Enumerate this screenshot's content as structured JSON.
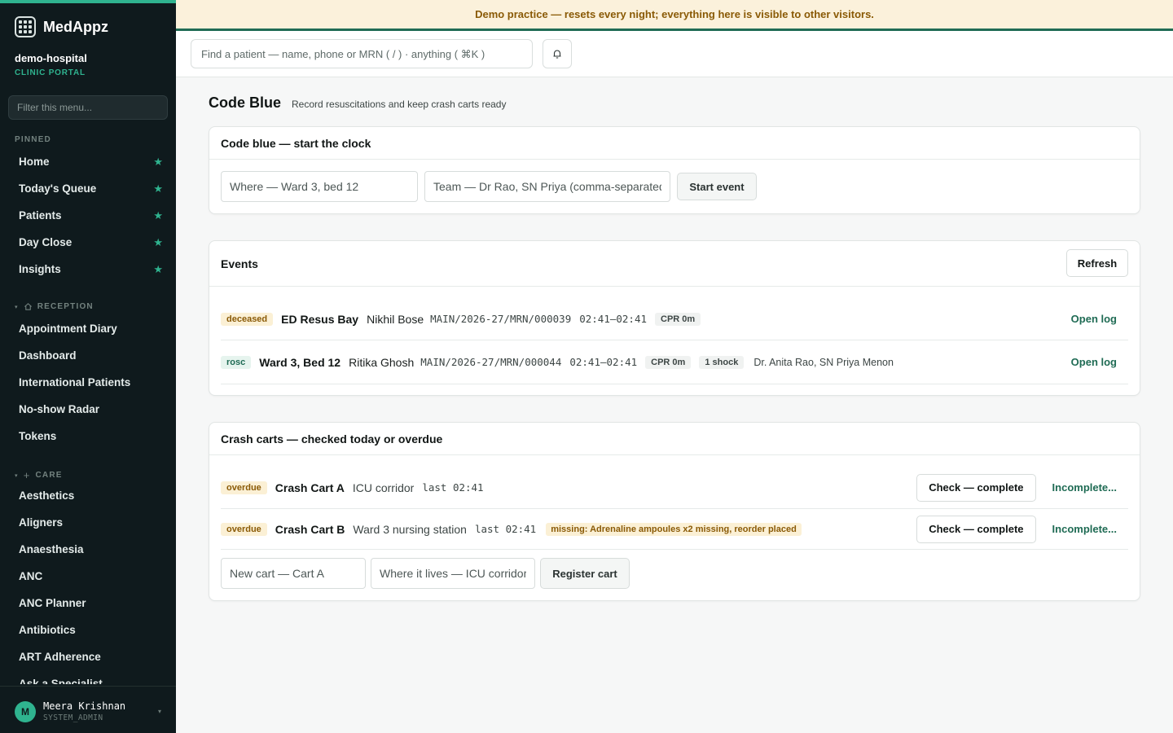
{
  "brand": {
    "name": "MedAppz"
  },
  "org": {
    "name": "demo-hospital",
    "subtitle": "CLINIC PORTAL"
  },
  "sidebar": {
    "filter_placeholder": "Filter this menu...",
    "pinned_label": "PINNED",
    "pinned": [
      {
        "label": "Home"
      },
      {
        "label": "Today's Queue"
      },
      {
        "label": "Patients"
      },
      {
        "label": "Day Close"
      },
      {
        "label": "Insights"
      }
    ],
    "reception_label": "RECEPTION",
    "reception": [
      {
        "label": "Appointment Diary"
      },
      {
        "label": "Dashboard"
      },
      {
        "label": "International Patients"
      },
      {
        "label": "No-show Radar"
      },
      {
        "label": "Tokens"
      }
    ],
    "care_label": "CARE",
    "care": [
      {
        "label": "Aesthetics"
      },
      {
        "label": "Aligners"
      },
      {
        "label": "Anaesthesia"
      },
      {
        "label": "ANC"
      },
      {
        "label": "ANC Planner"
      },
      {
        "label": "Antibiotics"
      },
      {
        "label": "ART Adherence"
      },
      {
        "label": "Ask a Specialist"
      }
    ]
  },
  "user": {
    "initial": "M",
    "name": "Meera Krishnan",
    "role": "SYSTEM_ADMIN"
  },
  "banner": {
    "text": "Demo practice — resets every night; everything here is visible to other visitors."
  },
  "topbar": {
    "search_placeholder": "Find a patient — name, phone or MRN ( / ) · anything ( ⌘K )"
  },
  "page": {
    "title": "Code Blue",
    "subtitle": "Record resuscitations and keep crash carts ready"
  },
  "start_card": {
    "title": "Code blue — start the clock",
    "where_placeholder": "Where — Ward 3, bed 12",
    "team_placeholder": "Team — Dr Rao, SN Priya (comma-separated)",
    "start_label": "Start event"
  },
  "events_card": {
    "title": "Events",
    "refresh_label": "Refresh",
    "events": [
      {
        "status": "deceased",
        "location": "ED Resus Bay",
        "patient": "Nikhil Bose",
        "mrn": "MAIN/2026-27/MRN/000039",
        "time": "02:41–02:41",
        "cpr": "CPR 0m",
        "shock": "",
        "team": "",
        "action": "Open log"
      },
      {
        "status": "rosc",
        "location": "Ward 3, Bed 12",
        "patient": "Ritika Ghosh",
        "mrn": "MAIN/2026-27/MRN/000044",
        "time": "02:41–02:41",
        "cpr": "CPR 0m",
        "shock": "1 shock",
        "team": "Dr. Anita Rao, SN Priya Menon",
        "action": "Open log"
      }
    ]
  },
  "carts_card": {
    "title": "Crash carts — checked today or overdue",
    "carts": [
      {
        "status": "overdue",
        "name": "Crash Cart A",
        "place": "ICU corridor",
        "last": "last 02:41",
        "missing": "",
        "check_label": "Check — complete",
        "incomplete_label": "Incomplete..."
      },
      {
        "status": "overdue",
        "name": "Crash Cart B",
        "place": "Ward 3 nursing station",
        "last": "last 02:41",
        "missing": "missing: Adrenaline ampoules x2 missing, reorder placed",
        "check_label": "Check — complete",
        "incomplete_label": "Incomplete..."
      }
    ],
    "new_cart_placeholder": "New cart — Cart A",
    "where_lives_placeholder": "Where it lives — ICU corridor",
    "register_label": "Register cart"
  }
}
